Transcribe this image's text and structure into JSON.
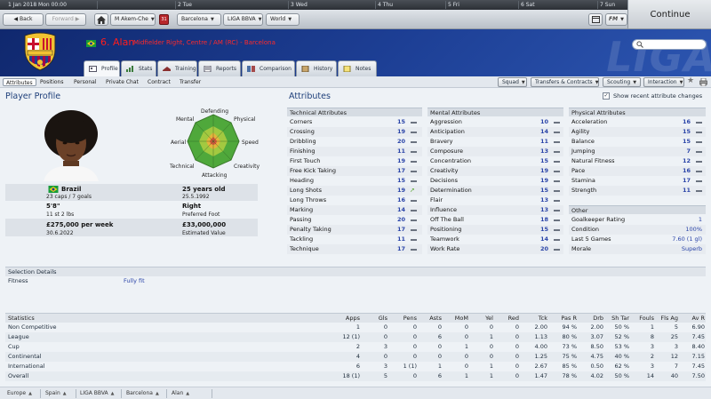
{
  "calendar": {
    "days": [
      "1 Jan 2018 Mon 00:00",
      "2 Tue",
      "3 Wed",
      "4 Thu",
      "5 Fri",
      "6 Sat",
      "7 Sun"
    ]
  },
  "toolbar": {
    "back": "Back",
    "forward": "Forward",
    "manager": "M Akem-Che",
    "inbox_count": "31",
    "club": "Barcelona",
    "league": "LIGA BBVA",
    "world": "World",
    "fm_menu": "FM"
  },
  "continue_label": "Continue",
  "player": {
    "name": "6. Alan",
    "subtitle": "Midfielder Right, Centre / AM (RC) - Barcelona"
  },
  "tabs": [
    "Profile",
    "Stats",
    "Training",
    "Reports",
    "Comparison",
    "History",
    "Notes"
  ],
  "subnav": {
    "items": [
      "Attributes",
      "Positions",
      "Personal",
      "Private Chat",
      "Contract",
      "Transfer"
    ],
    "dropdowns": [
      "Squad",
      "Transfers & Contracts",
      "Scouting",
      "Interaction"
    ]
  },
  "profile": {
    "title": "Player Profile",
    "radar_labels": [
      "Defending",
      "Physical",
      "Speed",
      "Creativity",
      "Attacking",
      "Technical",
      "Aerial",
      "Mental"
    ],
    "nation": "Brazil",
    "caps": "23 caps / 7 goals",
    "age": "25 years old",
    "dob": "25.5.1992",
    "height": "5'8\"",
    "weight": "11 st 2 lbs",
    "foot": "Right",
    "foot_label": "Preferred Foot",
    "wage": "£275,000 per week",
    "contract_end": "30.6.2022",
    "value": "£33,000,000",
    "value_label": "Estimated Value"
  },
  "attributes": {
    "title": "Attributes",
    "show_recent": "Show recent attribute changes",
    "technical": {
      "header": "Technical Attributes",
      "rows": [
        {
          "n": "Corners",
          "v": "15",
          "t": "flat"
        },
        {
          "n": "Crossing",
          "v": "19",
          "t": "flat"
        },
        {
          "n": "Dribbling",
          "v": "20",
          "t": "flat"
        },
        {
          "n": "Finishing",
          "v": "11",
          "t": "flat"
        },
        {
          "n": "First Touch",
          "v": "19",
          "t": "flat"
        },
        {
          "n": "Free Kick Taking",
          "v": "17",
          "t": "flat"
        },
        {
          "n": "Heading",
          "v": "15",
          "t": "flat"
        },
        {
          "n": "Long Shots",
          "v": "19",
          "t": "up"
        },
        {
          "n": "Long Throws",
          "v": "16",
          "t": "flat"
        },
        {
          "n": "Marking",
          "v": "14",
          "t": "flat"
        },
        {
          "n": "Passing",
          "v": "20",
          "t": "flat"
        },
        {
          "n": "Penalty Taking",
          "v": "17",
          "t": "flat"
        },
        {
          "n": "Tackling",
          "v": "11",
          "t": "flat"
        },
        {
          "n": "Technique",
          "v": "17",
          "t": "flat"
        }
      ]
    },
    "mental": {
      "header": "Mental Attributes",
      "rows": [
        {
          "n": "Aggression",
          "v": "10",
          "t": "flat"
        },
        {
          "n": "Anticipation",
          "v": "14",
          "t": "flat"
        },
        {
          "n": "Bravery",
          "v": "11",
          "t": "flat"
        },
        {
          "n": "Composure",
          "v": "13",
          "t": "flat"
        },
        {
          "n": "Concentration",
          "v": "15",
          "t": "flat"
        },
        {
          "n": "Creativity",
          "v": "19",
          "t": "flat"
        },
        {
          "n": "Decisions",
          "v": "19",
          "t": "flat"
        },
        {
          "n": "Determination",
          "v": "15",
          "t": "flat"
        },
        {
          "n": "Flair",
          "v": "13",
          "t": "flat"
        },
        {
          "n": "Influence",
          "v": "13",
          "t": "flat"
        },
        {
          "n": "Off The Ball",
          "v": "18",
          "t": "flat"
        },
        {
          "n": "Positioning",
          "v": "15",
          "t": "flat"
        },
        {
          "n": "Teamwork",
          "v": "14",
          "t": "flat"
        },
        {
          "n": "Work Rate",
          "v": "20",
          "t": "flat"
        }
      ]
    },
    "physical": {
      "header": "Physical Attributes",
      "rows": [
        {
          "n": "Acceleration",
          "v": "16",
          "t": "flat"
        },
        {
          "n": "Agility",
          "v": "15",
          "t": "flat"
        },
        {
          "n": "Balance",
          "v": "15",
          "t": "flat"
        },
        {
          "n": "Jumping",
          "v": "7",
          "t": "flat"
        },
        {
          "n": "Natural Fitness",
          "v": "12",
          "t": "flat"
        },
        {
          "n": "Pace",
          "v": "16",
          "t": "flat"
        },
        {
          "n": "Stamina",
          "v": "17",
          "t": "flat"
        },
        {
          "n": "Strength",
          "v": "11",
          "t": "flat"
        }
      ]
    },
    "other": {
      "header": "Other",
      "rows": [
        {
          "n": "Goalkeeper Rating",
          "v": "1"
        },
        {
          "n": "Condition",
          "v": "100%"
        },
        {
          "n": "Last 5 Games",
          "v": "7.60 (1 gl)"
        },
        {
          "n": "Morale",
          "v": "Superb"
        }
      ]
    }
  },
  "selection": {
    "header": "Selection Details",
    "label": "Fitness",
    "value": "Fully fit"
  },
  "stats": {
    "columns": [
      "Statistics",
      "Apps",
      "Gls",
      "Pens",
      "Asts",
      "MoM",
      "Yel",
      "Red",
      "Tck",
      "Pas R",
      "Drb",
      "Sh Tar",
      "Fouls",
      "Fls Ag",
      "Av R"
    ],
    "rows": [
      [
        "Non Competitive",
        "1",
        "0",
        "0",
        "0",
        "0",
        "0",
        "0",
        "2.00",
        "94 %",
        "2.00",
        "50 %",
        "1",
        "5",
        "6.90"
      ],
      [
        "League",
        "12 (1)",
        "0",
        "0",
        "6",
        "0",
        "1",
        "0",
        "1.13",
        "80 %",
        "3.07",
        "52 %",
        "8",
        "25",
        "7.45"
      ],
      [
        "Cup",
        "2",
        "3",
        "0",
        "0",
        "1",
        "0",
        "0",
        "4.00",
        "73 %",
        "8.50",
        "53 %",
        "3",
        "3",
        "8.40"
      ],
      [
        "Continental",
        "4",
        "0",
        "0",
        "0",
        "0",
        "0",
        "0",
        "1.25",
        "75 %",
        "4.75",
        "40 %",
        "2",
        "12",
        "7.15"
      ],
      [
        "International",
        "6",
        "3",
        "1 (1)",
        "1",
        "0",
        "1",
        "0",
        "2.67",
        "85 %",
        "0.50",
        "62 %",
        "3",
        "7",
        "7.45"
      ],
      [
        "Overall",
        "18 (1)",
        "5",
        "0",
        "6",
        "1",
        "1",
        "0",
        "1.47",
        "78 %",
        "4.02",
        "50 %",
        "14",
        "40",
        "7.50"
      ]
    ]
  },
  "breadcrumb": [
    "Europe",
    "Spain",
    "LIGA BBVA",
    "Barcelona",
    "Alan"
  ],
  "colors": {
    "header_blue": "#1d3f95",
    "name_red": "#ff1d1d",
    "attr_value_blue": "#2a44a8",
    "trend_up_green": "#58a62f"
  }
}
